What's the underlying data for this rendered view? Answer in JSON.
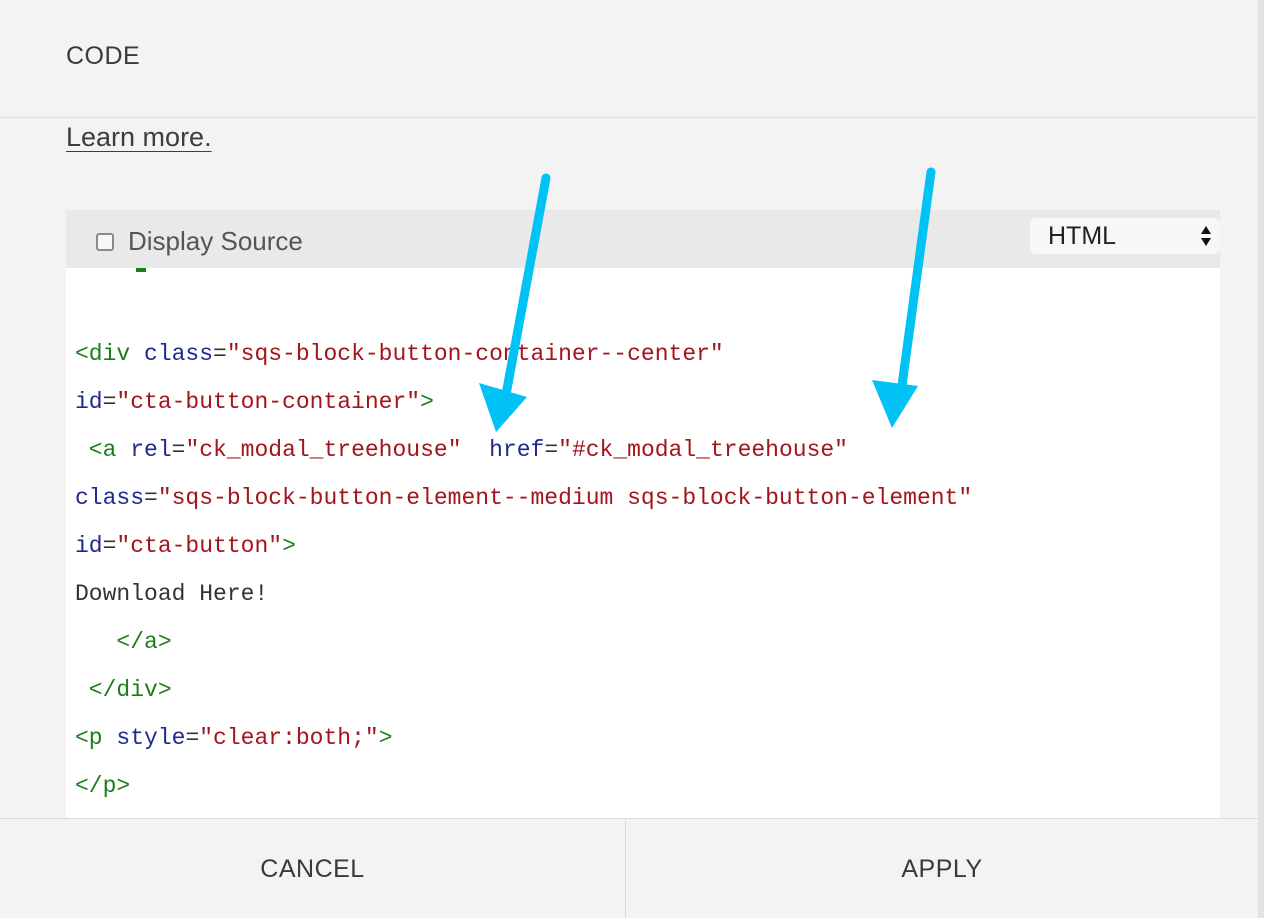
{
  "dialog": {
    "title": "CODE",
    "learn_more": "Learn more.",
    "display_source_label": "Display Source",
    "display_source_checked": false,
    "language_select": {
      "selected": "HTML"
    },
    "code_lines": [
      [
        {
          "t": "tag",
          "v": "<div "
        },
        {
          "t": "attr",
          "v": "class"
        },
        {
          "t": "eq",
          "v": "="
        },
        {
          "t": "str",
          "v": "\"sqs-block-button-container--center\""
        }
      ],
      [
        {
          "t": "attr",
          "v": "id"
        },
        {
          "t": "eq",
          "v": "="
        },
        {
          "t": "str",
          "v": "\"cta-button-container\""
        },
        {
          "t": "tag",
          "v": ">"
        }
      ],
      [
        {
          "t": "tag",
          "v": " <a "
        },
        {
          "t": "attr",
          "v": "rel"
        },
        {
          "t": "eq",
          "v": "="
        },
        {
          "t": "str",
          "v": "\"ck_modal_treehouse\""
        },
        {
          "t": "text",
          "v": "  "
        },
        {
          "t": "attr",
          "v": "href"
        },
        {
          "t": "eq",
          "v": "="
        },
        {
          "t": "str",
          "v": "\"#ck_modal_treehouse\""
        }
      ],
      [
        {
          "t": "attr",
          "v": "class"
        },
        {
          "t": "eq",
          "v": "="
        },
        {
          "t": "str",
          "v": "\"sqs-block-button-element--medium sqs-block-button-element\""
        }
      ],
      [
        {
          "t": "attr",
          "v": "id"
        },
        {
          "t": "eq",
          "v": "="
        },
        {
          "t": "str",
          "v": "\"cta-button\""
        },
        {
          "t": "tag",
          "v": ">"
        }
      ],
      [
        {
          "t": "text",
          "v": "Download Here!"
        }
      ],
      [
        {
          "t": "tag",
          "v": "   </a>"
        }
      ],
      [
        {
          "t": "tag",
          "v": " </div>"
        }
      ],
      [
        {
          "t": "tag",
          "v": "<p "
        },
        {
          "t": "attr",
          "v": "style"
        },
        {
          "t": "eq",
          "v": "="
        },
        {
          "t": "str",
          "v": "\"clear:both;\""
        },
        {
          "t": "tag",
          "v": ">"
        }
      ],
      [
        {
          "t": "tag",
          "v": "</p>"
        }
      ]
    ],
    "cancel_label": "CANCEL",
    "apply_label": "APPLY"
  },
  "annotations": {
    "arrow_color": "#00c2f5"
  }
}
